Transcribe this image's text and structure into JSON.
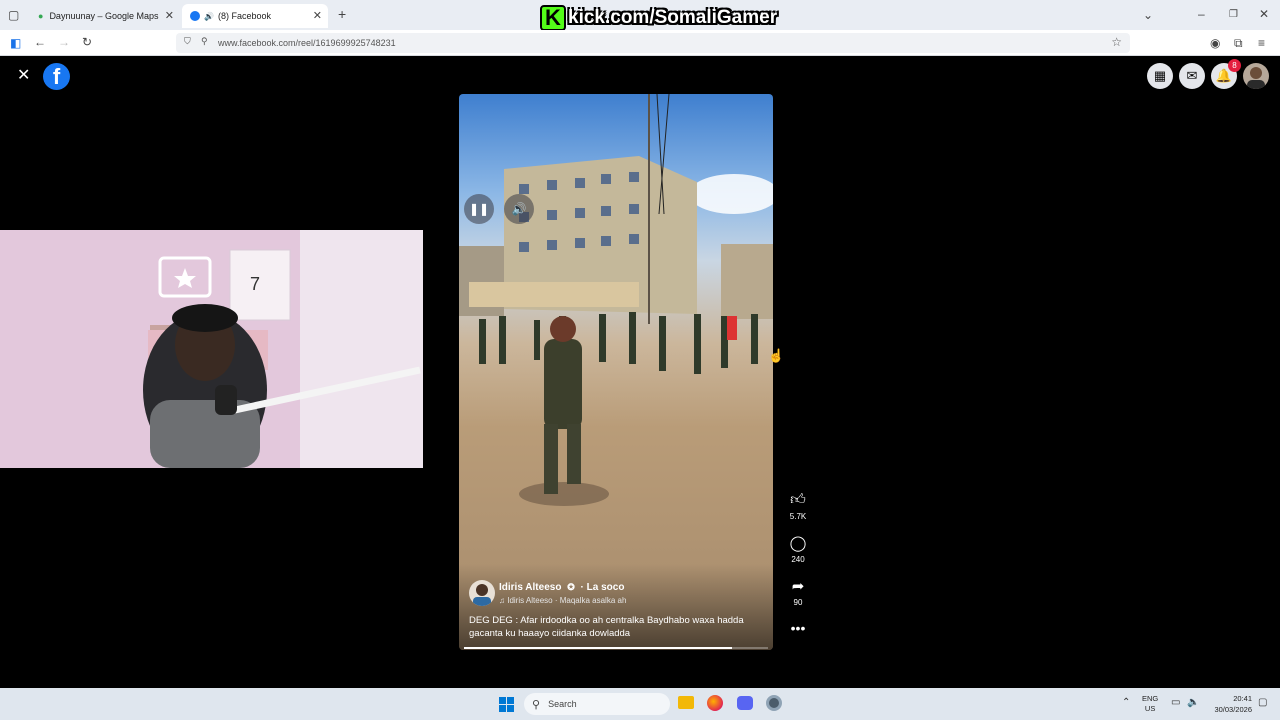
{
  "browser": {
    "tabs": [
      {
        "title": "Daynuunay – Google Maps",
        "active": false
      },
      {
        "title": "(8) Facebook",
        "active": true
      }
    ],
    "url": "www.facebook.com/reel/1619699925748231",
    "overlay_banner": "kick.com/SomaliGamer"
  },
  "facebook": {
    "notifications_count": "8"
  },
  "reel": {
    "author": "Idiris Alteeso",
    "follow_label": "· La soco",
    "audio_label": "Idiris Alteeso · Maqalka asalka ah",
    "caption_line1": "DEG DEG : Afar irdoodka oo ah centralka Baydhabo waxa hadda",
    "caption_line2": "gacanta ku haaayo ciidanka dowladda",
    "likes": "5.7K",
    "comments": "240",
    "shares": "90",
    "progress": 0.88
  },
  "taskbar": {
    "search_placeholder": "Search",
    "lang": "ENG",
    "region": "US",
    "time": "20:41",
    "date": "30/03/2026"
  },
  "colors": {
    "fb_blue": "#1877f2",
    "kick_green": "#53fc18",
    "notif_red": "#e41e3f"
  }
}
